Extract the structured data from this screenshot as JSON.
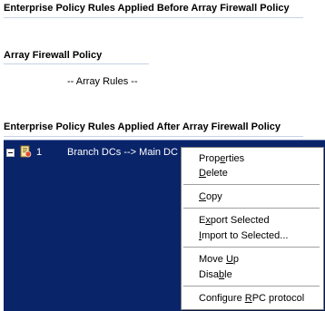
{
  "sections": {
    "before": {
      "title": "Enterprise Policy Rules Applied Before Array Firewall Policy"
    },
    "array": {
      "title": "Array Firewall Policy",
      "placeholder_text": "-- Array Rules --"
    },
    "after": {
      "title": "Enterprise Policy Rules Applied After Array Firewall Policy"
    }
  },
  "rules": [
    {
      "number": "1",
      "name": "Branch DCs --> Main DC",
      "icon": "rule-icon",
      "expanded": true,
      "selected": true
    }
  ],
  "context_menu": {
    "items": [
      {
        "label_pre": "Prop",
        "label_u": "e",
        "label_post": "rties"
      },
      {
        "label_pre": "",
        "label_u": "D",
        "label_post": "elete"
      },
      {
        "label_pre": "",
        "label_u": "C",
        "label_post": "opy"
      },
      {
        "label_pre": "E",
        "label_u": "x",
        "label_post": "port Selected"
      },
      {
        "label_pre": "",
        "label_u": "I",
        "label_post": "mport to Selected..."
      },
      {
        "label_pre": "Move ",
        "label_u": "U",
        "label_post": "p"
      },
      {
        "label_pre": "Disa",
        "label_u": "b",
        "label_post": "le"
      },
      {
        "label_pre": "Configure ",
        "label_u": "R",
        "label_post": "PC protocol"
      }
    ]
  },
  "colors": {
    "selection_background": "#0a246a",
    "header_underline": "#c6d3e6"
  }
}
